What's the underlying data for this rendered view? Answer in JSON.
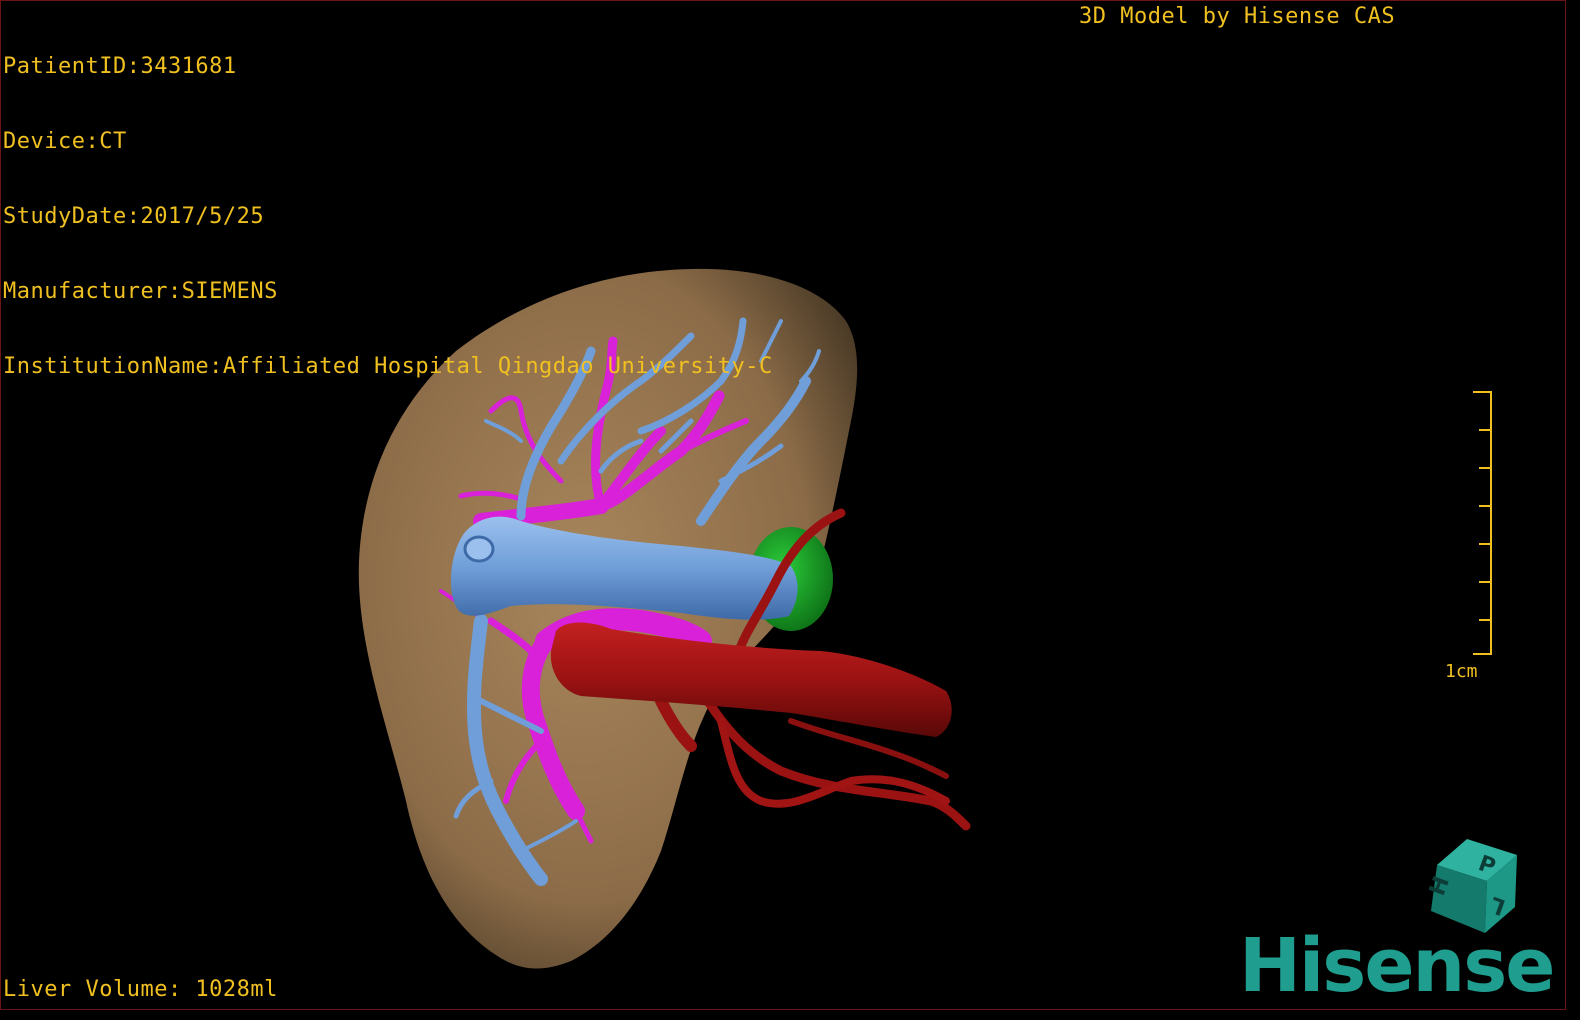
{
  "info": {
    "patient_id": "PatientID:3431681",
    "device": "Device:CT",
    "study_date": "StudyDate:2017/5/25",
    "manufacturer": "Manufacturer:SIEMENS",
    "institution": "InstitutionName:Affiliated Hospital Qingdao University-C"
  },
  "credit": "3D Model by Hisense CAS",
  "footer": {
    "liver_volume": "Liver Volume: 1028ml"
  },
  "scale": {
    "label": "1cm"
  },
  "orientation_cube": {
    "letters": [
      "P",
      "H",
      "L"
    ]
  },
  "brand": {
    "logo_text": "Hisense"
  },
  "colors": {
    "overlay_text": "#f0c020",
    "liver": "#9b7a52",
    "portal_vein": "#6f9ed8",
    "hepatic_vein": "#d821d8",
    "artery": "#a01414",
    "lesion": "#17a324",
    "brand": "#1f9e8f"
  }
}
